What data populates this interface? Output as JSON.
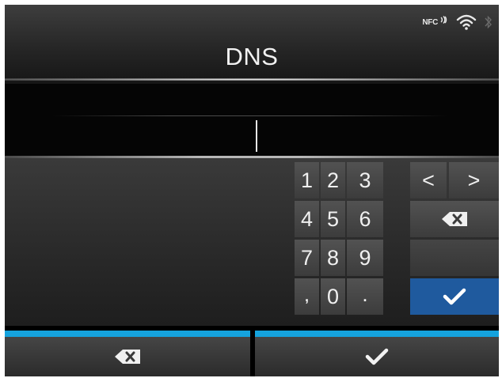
{
  "header": {
    "title": "DNS",
    "status_icons": [
      "nfc-icon",
      "wifi-icon",
      "bluetooth-icon"
    ],
    "nfc_label": "NFC"
  },
  "input": {
    "value": ""
  },
  "keypad": {
    "rows": [
      [
        "1",
        "2",
        "3"
      ],
      [
        "4",
        "5",
        "6"
      ],
      [
        "7",
        "8",
        "9"
      ],
      [
        ",",
        "0",
        "."
      ]
    ],
    "left_arrow": "<",
    "right_arrow": ">",
    "backspace_icon": "backspace-icon",
    "enter_icon": "checkmark-icon"
  },
  "bottom_buttons": {
    "left_icon": "backspace-icon",
    "right_icon": "checkmark-icon"
  },
  "colors": {
    "accent_blue": "#15a3de",
    "enter_key": "#1f5a9e"
  }
}
